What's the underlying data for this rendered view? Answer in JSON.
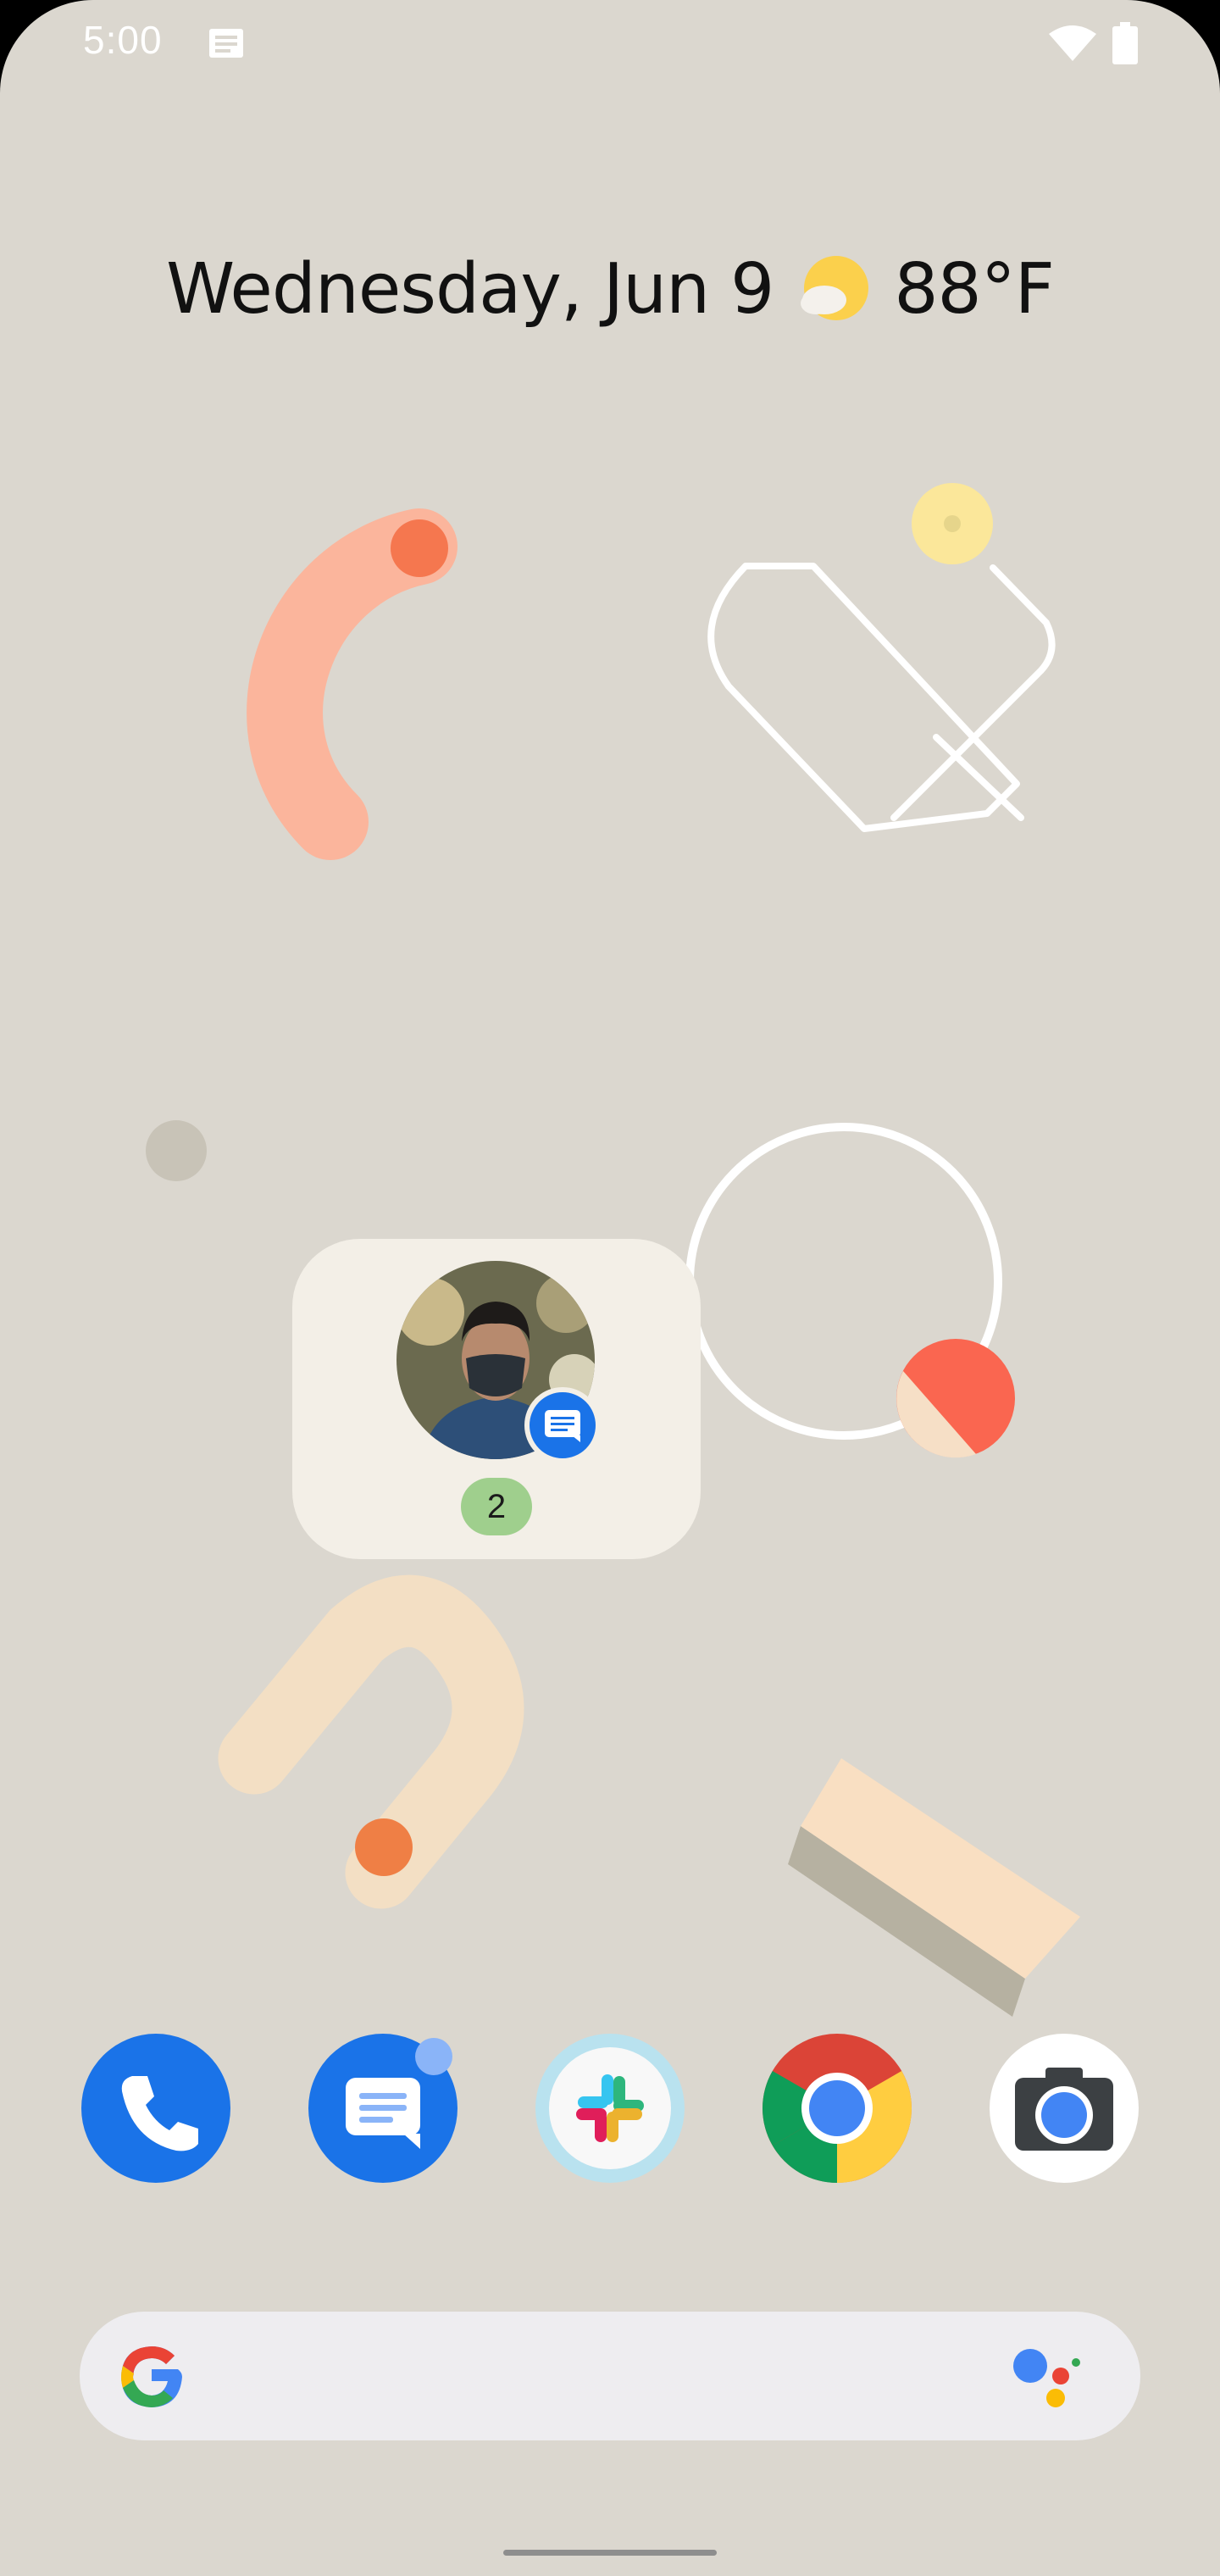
{
  "status_bar": {
    "time": "5:00",
    "icons": [
      "messages-notification-icon",
      "wifi-icon",
      "battery-icon"
    ]
  },
  "at_a_glance": {
    "date": "Wednesday, Jun 9",
    "weather_icon": "partly-cloudy-icon",
    "temperature": "88°F"
  },
  "conversation_widget": {
    "avatar": "contact-photo",
    "app_badge_icon": "messages-icon",
    "unread_count": "2"
  },
  "dock": {
    "apps": [
      {
        "name": "Phone",
        "icon": "phone-icon",
        "color": "#1a73e8"
      },
      {
        "name": "Messages",
        "icon": "messages-icon",
        "color": "#1a73e8"
      },
      {
        "name": "Slack",
        "icon": "slack-icon",
        "color": "#b9e2ef"
      },
      {
        "name": "Chrome",
        "icon": "chrome-icon",
        "color": "#db4437"
      },
      {
        "name": "Camera",
        "icon": "camera-icon",
        "color": "#ffffff"
      }
    ]
  },
  "search_bar": {
    "logo_icon": "google-g-icon",
    "assistant_icon": "google-assistant-icon"
  },
  "colors": {
    "wallpaper": "#dbd7cf",
    "accent": "#1a73e8",
    "widget_bg": "#f3efe7"
  }
}
